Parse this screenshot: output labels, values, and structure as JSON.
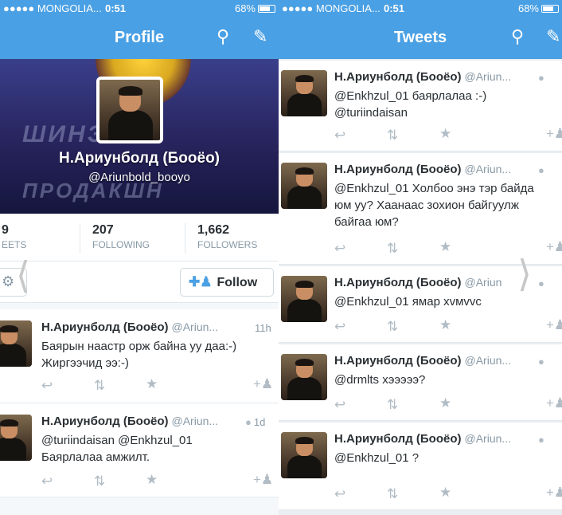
{
  "left": {
    "status": {
      "carrier": "●●●●● MONGOLIA...",
      "time": "0:51",
      "battery": "68%"
    },
    "nav_title": "Profile",
    "profile": {
      "name": "Н.Ариунболд (Бооёо)",
      "handle": "@Ariunbold_booyo",
      "cover_text_1": "ШИНЭ ҮЕ",
      "cover_text_2": "ПРОДАКШН"
    },
    "stats": [
      {
        "num": "9",
        "label": "EETS"
      },
      {
        "num": "207",
        "label": "FOLLOWING"
      },
      {
        "num": "1,662",
        "label": "FOLLOWERS"
      }
    ],
    "follow_label": "Follow",
    "tweets": [
      {
        "name": "Н.Ариунболд (Бооёо)",
        "handle": "@Ariun...",
        "time": "11h",
        "lines": [
          "Баярын наастр орж байна уу даа:-)",
          "Жиргээчид ээ:-)"
        ]
      },
      {
        "name": "Н.Ариунболд (Бооёо)",
        "handle": "@Ariun...",
        "time": "1d",
        "lines": [
          "@turiindaisan @Enkhzul_01",
          "Баярлалаа амжилт."
        ]
      }
    ]
  },
  "right": {
    "status": {
      "carrier": "●●●●● MONGOLIA...",
      "time": "0:51",
      "battery": "68%"
    },
    "nav_title": "Tweets",
    "tweets": [
      {
        "name": "Н.Ариунболд (Бооёо)",
        "handle": "@Ariun...",
        "lines": [
          "@Enkhzul_01 баярлалаа :-)",
          "@turiindaisan"
        ]
      },
      {
        "name": "Н.Ариунболд (Бооёо)",
        "handle": "@Ariun...",
        "lines": [
          "@Enkhzul_01 Холбоо энэ тэр байда",
          "юм уу? Хаанаас зохион байгуулж",
          "байгаа юм?"
        ]
      },
      {
        "name": "Н.Ариунболд (Бооёо)",
        "handle": "@Ariun",
        "lines": [
          "@Enkhzul_01 ямар хvмvvc"
        ]
      },
      {
        "name": "Н.Ариунболд (Бооёо)",
        "handle": "@Ariun...",
        "lines": [
          "@drmlts хэээээ?"
        ]
      },
      {
        "name": "Н.Ариунболд (Бооёо)",
        "handle": "@Ariun...",
        "lines": [
          "@Enkhzul_01 ?"
        ]
      }
    ]
  },
  "colors": {
    "accent": "#4aa0e4",
    "muted": "#8899a6",
    "icon": "#b1bcc5"
  }
}
